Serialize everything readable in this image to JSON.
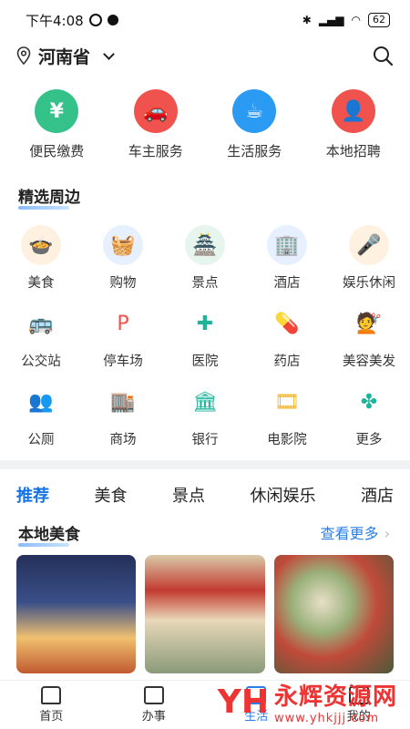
{
  "status": {
    "time": "下午4:08",
    "battery": "62"
  },
  "location": {
    "province": "河南省"
  },
  "services": [
    {
      "label": "便民缴费",
      "color": "#34c18a",
      "glyph": "¥"
    },
    {
      "label": "车主服务",
      "color": "#f0534d",
      "glyph": "🚗"
    },
    {
      "label": "生活服务",
      "color": "#2b9af3",
      "glyph": "☕"
    },
    {
      "label": "本地招聘",
      "color": "#f0534d",
      "glyph": "👤"
    }
  ],
  "nearby": {
    "title": "精选周边",
    "items": [
      {
        "label": "美食",
        "glyph": "🍲",
        "bg": "#fff1e0",
        "fg": "#f08a2c"
      },
      {
        "label": "购物",
        "glyph": "🧺",
        "bg": "#e6f0ff",
        "fg": "#3b7ff0"
      },
      {
        "label": "景点",
        "glyph": "🏯",
        "bg": "#e6f6ee",
        "fg": "#1fae6d"
      },
      {
        "label": "酒店",
        "glyph": "🏢",
        "bg": "#e6f0ff",
        "fg": "#3b7ff0"
      },
      {
        "label": "娱乐休闲",
        "glyph": "🎤",
        "bg": "#fff1e0",
        "fg": "#f08a2c"
      },
      {
        "label": "公交站",
        "glyph": "🚌",
        "bg": "#ffffff",
        "fg": "#2b7fe6"
      },
      {
        "label": "停车场",
        "glyph": "P",
        "bg": "#ffffff",
        "fg": "#f0534d"
      },
      {
        "label": "医院",
        "glyph": "✚",
        "bg": "#ffffff",
        "fg": "#1fb39a"
      },
      {
        "label": "药店",
        "glyph": "💊",
        "bg": "#ffffff",
        "fg": "#f5b530"
      },
      {
        "label": "美容美发",
        "glyph": "💇",
        "bg": "#ffffff",
        "fg": "#2b7fe6"
      },
      {
        "label": "公厕",
        "glyph": "👥",
        "bg": "#ffffff",
        "fg": "#2b7fe6"
      },
      {
        "label": "商场",
        "glyph": "🏬",
        "bg": "#ffffff",
        "fg": "#f0534d"
      },
      {
        "label": "银行",
        "glyph": "🏛",
        "bg": "#ffffff",
        "fg": "#1fb39a"
      },
      {
        "label": "电影院",
        "glyph": "🎞",
        "bg": "#ffffff",
        "fg": "#f5b530"
      },
      {
        "label": "更多",
        "glyph": "✤",
        "bg": "#ffffff",
        "fg": "#1fb39a"
      }
    ]
  },
  "tabs": [
    "推荐",
    "美食",
    "景点",
    "休闲娱乐",
    "酒店"
  ],
  "local": {
    "title": "本地美食",
    "more": "查看更多"
  },
  "cards": [
    {
      "name": "card-restaurant-1",
      "color": "#1d2c55"
    },
    {
      "name": "card-restaurant-2",
      "color": "#b04a3a"
    },
    {
      "name": "card-restaurant-3",
      "color": "#3b5a3a"
    }
  ],
  "nav": [
    {
      "label": "首页",
      "active": false
    },
    {
      "label": "办事",
      "active": false
    },
    {
      "label": "生活",
      "active": true
    },
    {
      "label": "我的",
      "active": false
    }
  ],
  "watermark": {
    "logo": "YH",
    "name": "永辉资源网",
    "url": "www.yhkjjj.com"
  }
}
